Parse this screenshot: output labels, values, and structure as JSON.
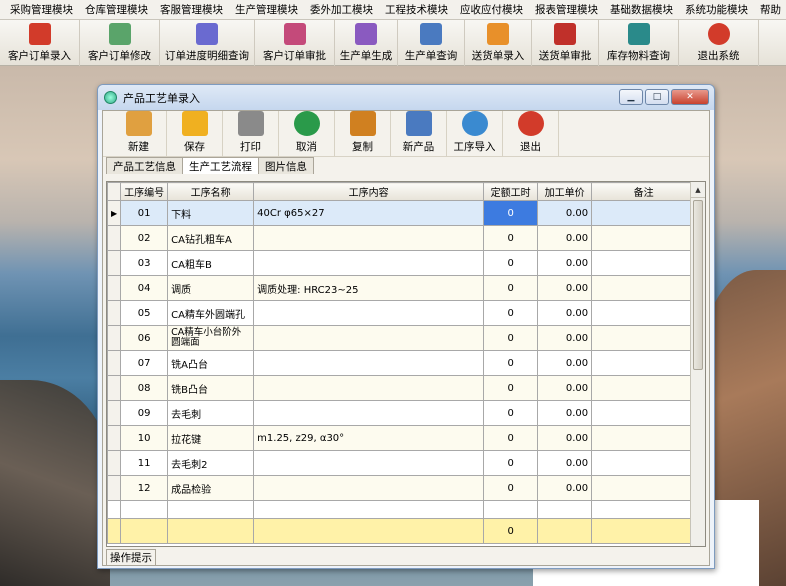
{
  "menu": [
    "采购管理模块",
    "仓库管理模块",
    "客服管理模块",
    "生产管理模块",
    "委外加工模块",
    "工程技术模块",
    "应收应付模块",
    "报表管理模块",
    "基础数据模块",
    "系统功能模块",
    "帮助"
  ],
  "toolbar": [
    {
      "label": "客户订单录入",
      "icon": "pdf-icon",
      "color": "#d23b2a"
    },
    {
      "label": "客户订单修改",
      "icon": "tools-icon",
      "color": "#5aa46a"
    },
    {
      "label": "订单进度明细查询",
      "icon": "pen-icon",
      "color": "#6a6ad0"
    },
    {
      "label": "客户订单审批",
      "icon": "approve-icon",
      "color": "#c44a7a"
    },
    {
      "label": "生产单生成",
      "icon": "gear-icon",
      "color": "#8a5ac0"
    },
    {
      "label": "生产单查询",
      "icon": "search-icon",
      "color": "#4a7ac0"
    },
    {
      "label": "送货单录入",
      "icon": "flower-icon",
      "color": "#e8902a"
    },
    {
      "label": "送货单审批",
      "icon": "truck-icon",
      "color": "#c0302a"
    },
    {
      "label": "库存物料查询",
      "icon": "feather-icon",
      "color": "#2a8a8a"
    },
    {
      "label": "退出系统",
      "icon": "power-icon",
      "color": "#d23b2a"
    }
  ],
  "window": {
    "title": "产品工艺单录入",
    "tools": [
      {
        "label": "新建",
        "icon": "new-doc-icon",
        "color": "#e0a040"
      },
      {
        "label": "保存",
        "icon": "save-icon",
        "color": "#f0b020"
      },
      {
        "label": "打印",
        "icon": "print-icon",
        "color": "#8a8a8a"
      },
      {
        "label": "取消",
        "icon": "undo-icon",
        "color": "#2a9a4a"
      },
      {
        "label": "复制",
        "icon": "copy-icon",
        "color": "#d08020"
      },
      {
        "label": "新产品",
        "icon": "new-product-icon",
        "color": "#4a7ac0"
      },
      {
        "label": "工序导入",
        "icon": "import-icon",
        "color": "#3a8ad0"
      },
      {
        "label": "退出",
        "icon": "exit-icon",
        "color": "#d23b2a"
      }
    ],
    "tabs": [
      "产品工艺信息",
      "生产工艺流程",
      "图片信息"
    ],
    "columns": [
      "工序编号",
      "工序名称",
      "工序内容",
      "定额工时",
      "加工单价",
      "备注"
    ],
    "rows": [
      {
        "no": "01",
        "name": "下料",
        "content": "40Cr  φ65×27",
        "hours": "0",
        "price": "0.00",
        "note": ""
      },
      {
        "no": "02",
        "name": "CA钻孔粗车A",
        "content": "",
        "hours": "0",
        "price": "0.00",
        "note": ""
      },
      {
        "no": "03",
        "name": "CA粗车B",
        "content": "",
        "hours": "0",
        "price": "0.00",
        "note": ""
      },
      {
        "no": "04",
        "name": "调质",
        "content": "调质处理: HRC23~25",
        "hours": "0",
        "price": "0.00",
        "note": ""
      },
      {
        "no": "05",
        "name": "CA精车外圆端孔",
        "content": "",
        "hours": "0",
        "price": "0.00",
        "note": ""
      },
      {
        "no": "06",
        "name": "CA精车小台阶外圆端面",
        "content": "",
        "hours": "0",
        "price": "0.00",
        "note": ""
      },
      {
        "no": "07",
        "name": "铣A凸台",
        "content": "",
        "hours": "0",
        "price": "0.00",
        "note": ""
      },
      {
        "no": "08",
        "name": "铣B凸台",
        "content": "",
        "hours": "0",
        "price": "0.00",
        "note": ""
      },
      {
        "no": "09",
        "name": "去毛刺",
        "content": "",
        "hours": "0",
        "price": "0.00",
        "note": ""
      },
      {
        "no": "10",
        "name": "拉花键",
        "content": "m1.25, z29, α30°",
        "hours": "0",
        "price": "0.00",
        "note": ""
      },
      {
        "no": "11",
        "name": "去毛刺2",
        "content": "",
        "hours": "0",
        "price": "0.00",
        "note": ""
      },
      {
        "no": "12",
        "name": "成品检验",
        "content": "",
        "hours": "0",
        "price": "0.00",
        "note": ""
      }
    ],
    "total_hours": "0",
    "status": "操作提示"
  }
}
